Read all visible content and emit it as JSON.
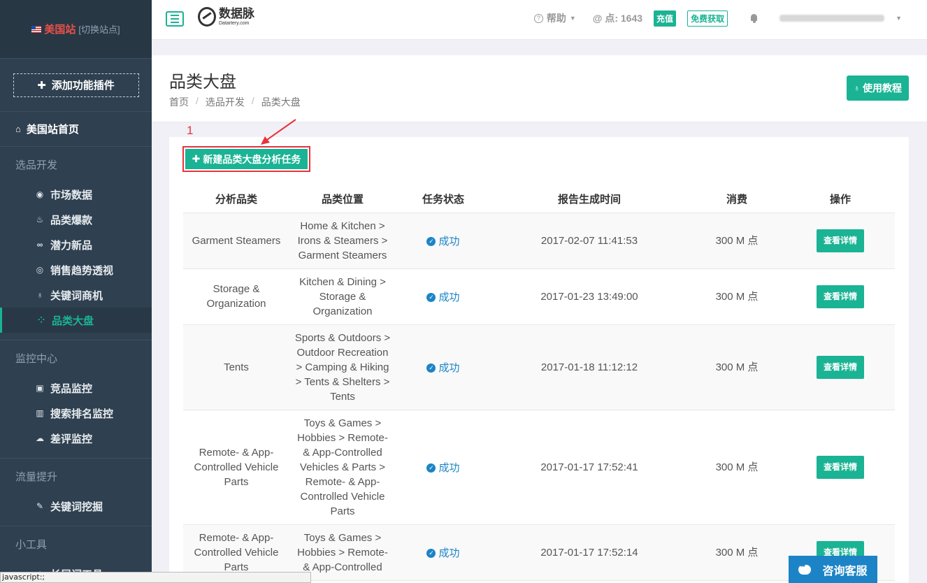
{
  "sidebar": {
    "site_name": "美国站",
    "site_switch": "[切换站点]",
    "add_plugin": "添加功能插件",
    "home": "美国站首页",
    "sections": [
      {
        "title": "选品开发",
        "items": [
          {
            "label": "市场数据",
            "icon": "compass-icon"
          },
          {
            "label": "品类爆款",
            "icon": "fire-icon"
          },
          {
            "label": "潜力新品",
            "icon": "link-icon"
          },
          {
            "label": "销售趋势透视",
            "icon": "target-icon"
          },
          {
            "label": "关键词商机",
            "icon": "lightbulb-icon"
          },
          {
            "label": "品类大盘",
            "icon": "grid-icon"
          }
        ]
      },
      {
        "title": "监控中心",
        "items": [
          {
            "label": "竞品监控",
            "icon": "image-icon"
          },
          {
            "label": "搜索排名监控",
            "icon": "bar-chart-icon"
          },
          {
            "label": "差评监控",
            "icon": "comments-icon"
          }
        ]
      },
      {
        "title": "流量提升",
        "items": [
          {
            "label": "关键词挖掘",
            "icon": "pencil-icon"
          }
        ]
      },
      {
        "title": "小工具",
        "items": [
          {
            "label": "长尾词工具",
            "icon": "tool-icon"
          }
        ]
      }
    ]
  },
  "topbar": {
    "logo_cn": "数据脉",
    "logo_en": "Datartery.com",
    "help": "帮助",
    "points": "点: 1643",
    "recharge": "充值",
    "free": "免费获取"
  },
  "header": {
    "title": "品类大盘",
    "breadcrumb": [
      "首页",
      "选品开发",
      "品类大盘"
    ],
    "tutorial": "使用教程"
  },
  "annotation": "1",
  "new_task": "新建品类大盘分析任务",
  "table": {
    "columns": [
      "分析品类",
      "品类位置",
      "任务状态",
      "报告生成时间",
      "消费",
      "操作"
    ],
    "rows": [
      {
        "category": "Garment Steamers",
        "location": "Home & Kitchen > Irons & Steamers > Garment Steamers",
        "status": "成功",
        "time": "2017-02-07 11:41:53",
        "cost": "300 M 点",
        "action": "查看详情"
      },
      {
        "category": "Storage & Organization",
        "location": "Kitchen & Dining > Storage & Organization",
        "status": "成功",
        "time": "2017-01-23 13:49:00",
        "cost": "300 M 点",
        "action": "查看详情"
      },
      {
        "category": "Tents",
        "location": "Sports & Outdoors > Outdoor Recreation > Camping & Hiking > Tents & Shelters > Tents",
        "status": "成功",
        "time": "2017-01-18 11:12:12",
        "cost": "300 M 点",
        "action": "查看详情"
      },
      {
        "category": "Remote- & App-Controlled Vehicle Parts",
        "location": "Toys & Games > Hobbies > Remote- & App-Controlled Vehicles & Parts > Remote- & App-Controlled Vehicle Parts",
        "status": "成功",
        "time": "2017-01-17 17:52:41",
        "cost": "300 M 点",
        "action": "查看详情"
      },
      {
        "category": "Remote- & App-Controlled Vehicle Parts",
        "location": "Toys & Games > Hobbies > Remote- & App-Controlled",
        "status": "成功",
        "time": "2017-01-17 17:52:14",
        "cost": "300 M 点",
        "action": "查看详情"
      }
    ]
  },
  "consult": "咨询客服",
  "status_bar": "javascript:;"
}
